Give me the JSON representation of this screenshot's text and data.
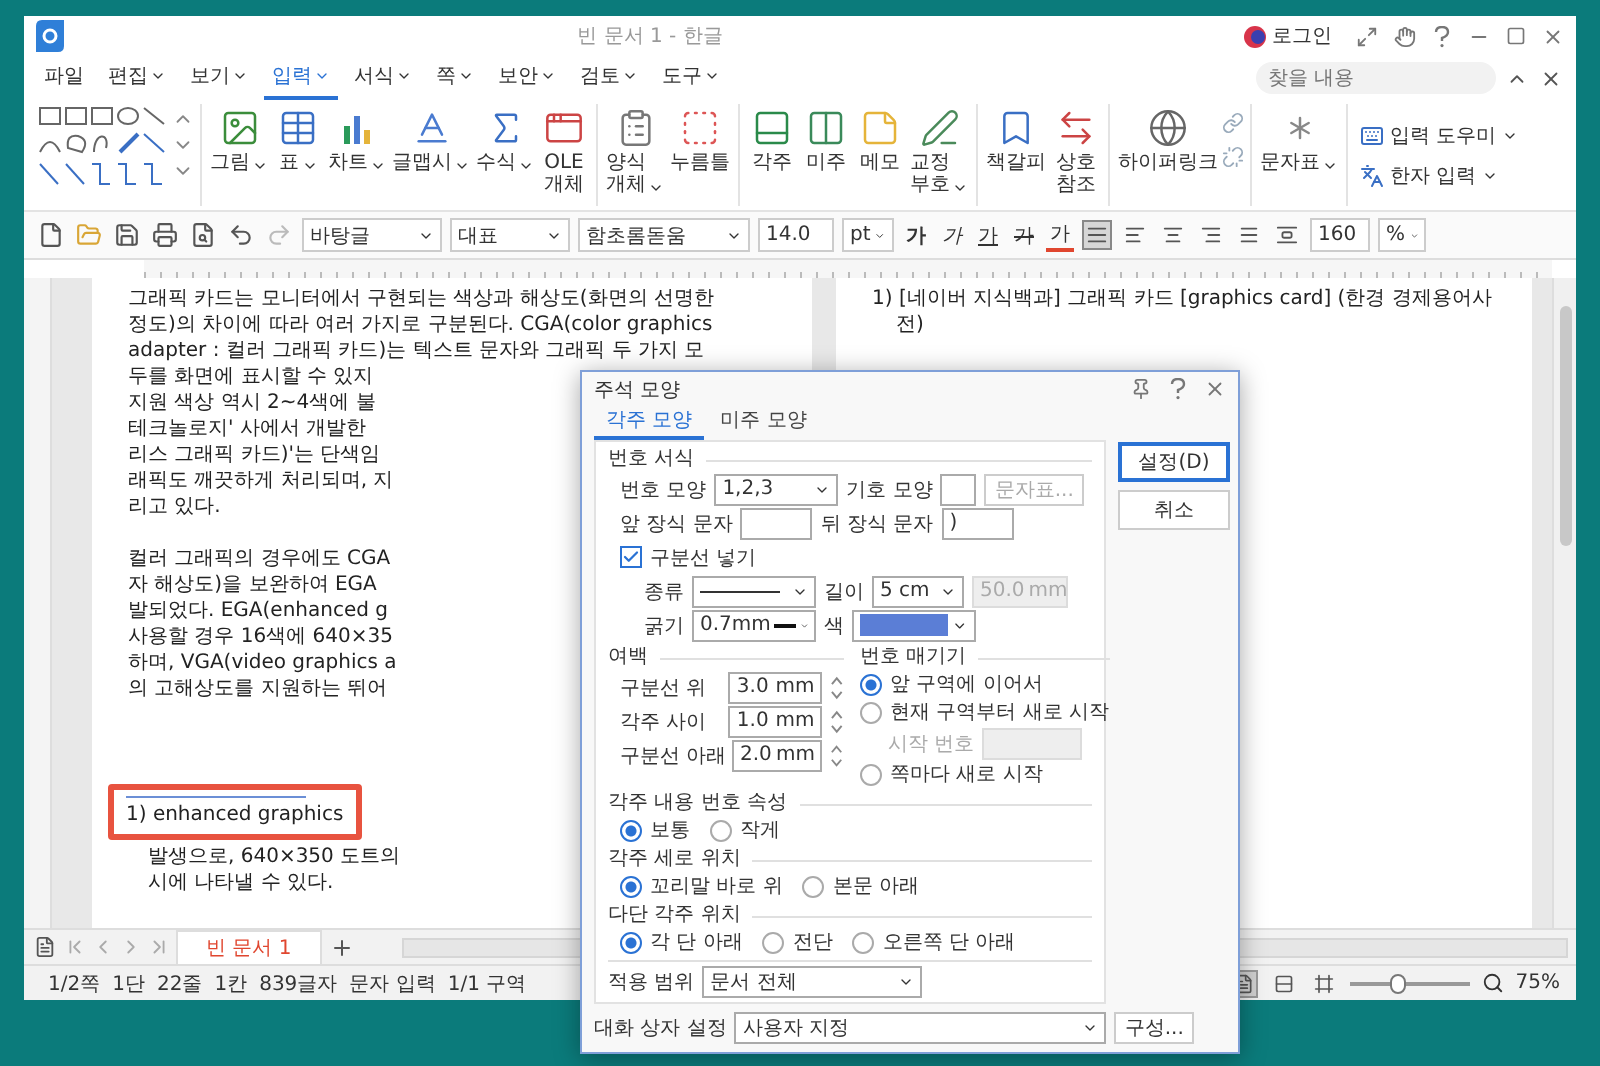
{
  "window": {
    "title": "빈 문서 1 - 한글",
    "login": "로그인",
    "search": {
      "placeholder": "찾을 내용"
    }
  },
  "menu": [
    {
      "label": "파일",
      "selected": false,
      "dropdown": false
    },
    {
      "label": "편집",
      "selected": false,
      "dropdown": true
    },
    {
      "label": "보기",
      "selected": false,
      "dropdown": true
    },
    {
      "label": "입력",
      "selected": true,
      "dropdown": true
    },
    {
      "label": "서식",
      "selected": false,
      "dropdown": true
    },
    {
      "label": "쪽",
      "selected": false,
      "dropdown": true
    },
    {
      "label": "보안",
      "selected": false,
      "dropdown": true
    },
    {
      "label": "검토",
      "selected": false,
      "dropdown": true
    },
    {
      "label": "도구",
      "selected": false,
      "dropdown": true
    }
  ],
  "ribbon": {
    "groups": [
      [
        {
          "label": "그림",
          "dropdown": true
        },
        {
          "label": "표",
          "dropdown": true
        },
        {
          "label": "차트",
          "dropdown": true
        },
        {
          "label": "글맵시",
          "dropdown": true
        },
        {
          "label": "수식",
          "dropdown": true
        },
        {
          "label": "OLE\n개체",
          "dropdown": false
        }
      ],
      [
        {
          "label": "양식\n개체",
          "dropdown": true
        },
        {
          "label": "누름틀",
          "dropdown": false
        }
      ],
      [
        {
          "label": "각주",
          "dropdown": false
        },
        {
          "label": "미주",
          "dropdown": false
        },
        {
          "label": "메모",
          "dropdown": false
        },
        {
          "label": "교정\n부호",
          "dropdown": true
        }
      ],
      [
        {
          "label": "책갈피",
          "dropdown": false
        },
        {
          "label": "상호\n참조",
          "dropdown": false
        }
      ],
      [
        {
          "label": "하이퍼링크",
          "dropdown": false
        }
      ],
      [
        {
          "label": "문자표",
          "dropdown": true
        }
      ]
    ],
    "small_tools": [
      {
        "label": "입력 도우미",
        "dropdown": true
      },
      {
        "label": "한자 입력",
        "dropdown": true
      }
    ]
  },
  "toolbar": {
    "style": "바탕글",
    "outline": "대표",
    "font": "함초롬돋움",
    "size": "14.0",
    "size_unit": "pt",
    "format_buttons": [
      {
        "label": "가",
        "kind": "bold"
      },
      {
        "label": "가",
        "kind": "italic"
      },
      {
        "label": "가",
        "kind": "underline"
      },
      {
        "label": "가",
        "kind": "strike"
      },
      {
        "label": "가",
        "kind": "color"
      }
    ],
    "align_buttons": [
      {
        "selected": true
      },
      {
        "selected": false
      },
      {
        "selected": false
      },
      {
        "selected": false
      },
      {
        "selected": false
      },
      {
        "selected": false
      }
    ],
    "zoom": "160",
    "zoom_unit": "%"
  },
  "document": {
    "page_1": {
      "paragraphs": [
        [
          "그래픽 카드는 모니터에서 구현되는 색상과 해상도(화면의 선명한",
          "정도)의 차이에 따라 여러 가지로 구분된다. CGA(color graphics",
          "adapter : 컬러 그래픽 카드)는 텍스트 문자와 그래픽 두 가지 모",
          "두를 화면에 표시할 수 있지",
          "지원 색상 역시 2∼4색에 불",
          "테크놀로지' 사에서 개발한",
          "리스 그래픽 카드)'는 단색임",
          "래픽도 깨끗하게 처리되며, 지",
          "리고 있다."
        ],
        [
          "컬러 그래픽의 경우에도 CGA",
          "자 해상도)을 보완하여 EGA",
          "발되었다. EGA(enhanced g",
          "사용할 경우 16색에 640×35",
          "하며, VGA(video graphics a",
          "의 고해상도를 지원하는 뛰어"
        ]
      ],
      "footnote": "1) enhanced graphics",
      "footnote_lines": [
        "발생으로, 640×350 도트의",
        "시에 나타낼 수 있다."
      ]
    },
    "page_2": {
      "footnote_lines": [
        "1) [네이버 지식백과] 그래픽 카드 [graphics card] (한경 경제용어사",
        "전)"
      ]
    }
  },
  "doc_tabs": [
    {
      "label": "빈 문서 1",
      "selected": true
    }
  ],
  "status_bar": {
    "items": [
      "1/2쪽",
      "1단",
      "22줄",
      "1칸",
      "839글자",
      "문자 입력",
      "1/1 구역"
    ],
    "view_buttons": [
      {
        "selected": true
      },
      {
        "selected": false
      },
      {
        "selected": false
      }
    ],
    "zoom_slider": {
      "level": 0.4
    },
    "zoom": "75%"
  },
  "dialog": {
    "title": "주석 모양",
    "tabs": [
      {
        "label": "각주 모양",
        "selected": true
      },
      {
        "label": "미주 모양",
        "selected": false
      }
    ],
    "buttons": [
      {
        "label": "설정(D)",
        "primary": true
      },
      {
        "label": "취소",
        "primary": false
      }
    ],
    "number_format": {
      "heading": "번호 서식",
      "shape_label": "번호 모양",
      "shape": "1,2,3",
      "symbol_label": "기호 모양",
      "symbol_button": {
        "label": "문자표...",
        "disabled": true
      },
      "prefix_label": "앞 장식 문자",
      "suffix_label": "뒤 장식 문자",
      "suffix": ")",
      "separator": {
        "label": "구분선 넣기",
        "checked": true
      },
      "type_label": "종류",
      "length_label": "길이",
      "length": "5 cm",
      "length_mm": {
        "value": "50.0",
        "unit": "mm",
        "disabled": true
      },
      "thickness_label": "굵기",
      "thickness": "0.7mm",
      "color_label": "색",
      "color": "#5b7ed6"
    },
    "margins": {
      "heading": "여백",
      "rows": [
        {
          "label": "구분선 위",
          "value": "3.0",
          "unit": "mm"
        },
        {
          "label": "각주 사이",
          "value": "1.0",
          "unit": "mm"
        },
        {
          "label": "구분선 아래",
          "value": "2.0",
          "unit": "mm"
        }
      ]
    },
    "numbering": {
      "heading": "번호 매기기",
      "options": [
        {
          "label": "앞 구역에 이어서",
          "selected": true
        },
        {
          "label": "현재 구역부터 새로 시작",
          "selected": false
        },
        {
          "label": "쪽마다 새로 시작",
          "selected": false
        }
      ],
      "start": {
        "label": "시작 번호",
        "disabled": true
      }
    },
    "radio_groups": [
      {
        "heading": "각주 내용 번호 속성",
        "options": [
          {
            "label": "보통",
            "selected": true
          },
          {
            "label": "작게",
            "selected": false
          }
        ]
      },
      {
        "heading": "각주 세로 위치",
        "options": [
          {
            "label": "꼬리말 바로 위",
            "selected": true
          },
          {
            "label": "본문 아래",
            "selected": false
          }
        ]
      },
      {
        "heading": "다단 각주 위치",
        "options": [
          {
            "label": "각 단 아래",
            "selected": true
          },
          {
            "label": "전단",
            "selected": false
          },
          {
            "label": "오른쪽 단 아래",
            "selected": false
          }
        ]
      }
    ],
    "scope": {
      "label": "적용 범위",
      "value": "문서 전체"
    },
    "footer": {
      "label": "대화 상자 설정",
      "value": "사용자 지정",
      "button": "구성..."
    }
  }
}
